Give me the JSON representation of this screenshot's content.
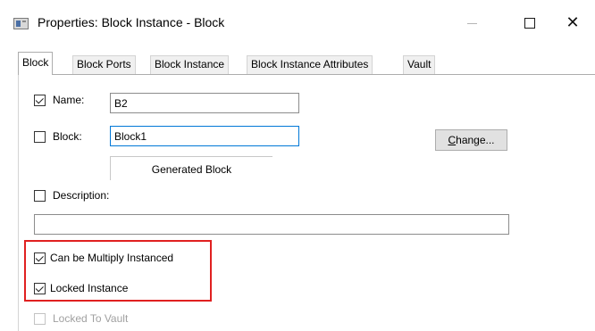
{
  "window": {
    "title": "Properties: Block Instance - Block",
    "minimize_glyph": "",
    "close_glyph": "✕"
  },
  "tabs": [
    {
      "label": "Block",
      "active": true
    },
    {
      "label": "Block Ports"
    },
    {
      "label": "Block Instance"
    },
    {
      "label": "Block Instance Attributes"
    },
    {
      "label": "Vault"
    }
  ],
  "form": {
    "name": {
      "label": "Name:",
      "checked": true,
      "value": "B2"
    },
    "block": {
      "label": "Block:",
      "checked": false,
      "value": "Block1",
      "caption": "Generated Block"
    },
    "change_button": {
      "label_underlined": "C",
      "label_rest": "hange..."
    },
    "description": {
      "label": "Description:",
      "checked": false,
      "value": ""
    },
    "can_be_multiply_instanced": {
      "label": "Can be Multiply Instanced",
      "checked": true
    },
    "locked_instance": {
      "label": "Locked Instance",
      "checked": true
    },
    "locked_to_vault": {
      "label": "Locked To Vault",
      "checked": false,
      "disabled": true
    }
  },
  "colors": {
    "highlight": "#e02020",
    "focus_border": "#0078d7"
  }
}
